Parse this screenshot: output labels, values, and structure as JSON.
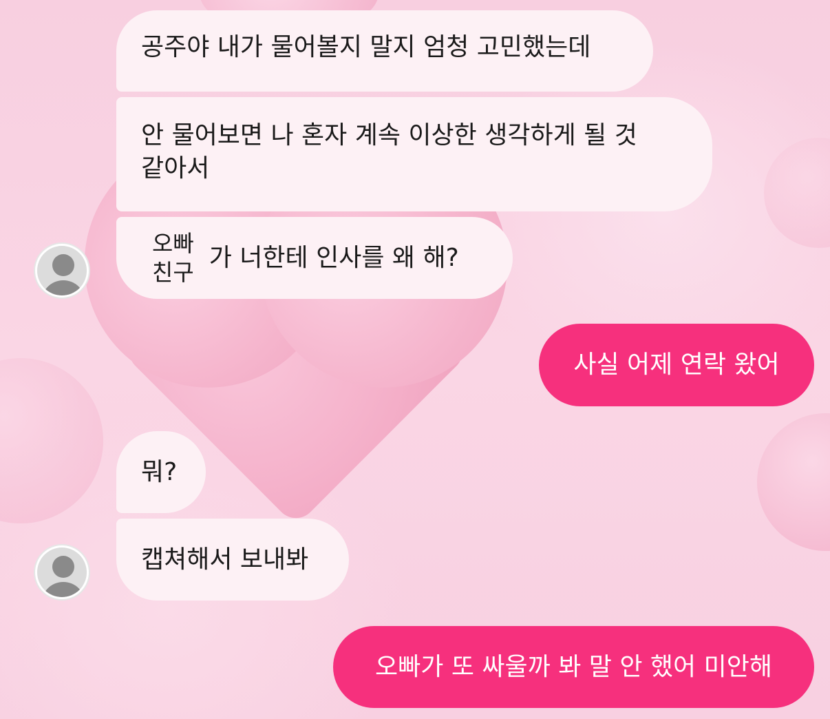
{
  "theme": {
    "incoming_bubble": "#fdf1f5",
    "outgoing_bubble": "#f6307d",
    "background": "#f9d2e2"
  },
  "messages": [
    {
      "id": "m1",
      "direction": "incoming",
      "text": "공주야 내가 물어볼지 말지 엄청 고민했는데"
    },
    {
      "id": "m2",
      "direction": "incoming",
      "line1": "안 물어보면 나 혼자 계속 이상한 생각하게 될 것",
      "line2": "같아서"
    },
    {
      "id": "m3",
      "direction": "incoming",
      "redacted_line1": "오빠",
      "redacted_line2": "친구",
      "text": "가 너한테 인사를 왜 해?",
      "avatar": "default-profile-icon"
    },
    {
      "id": "m4",
      "direction": "outgoing",
      "text": "사실 어제 연락 왔어"
    },
    {
      "id": "m5",
      "direction": "incoming",
      "text": "뭐?"
    },
    {
      "id": "m6",
      "direction": "incoming",
      "text": "캡쳐해서 보내봐",
      "avatar": "default-profile-icon"
    },
    {
      "id": "m7",
      "direction": "outgoing",
      "text": "오빠가 또 싸울까 봐 말 안 했어 미안해"
    }
  ]
}
